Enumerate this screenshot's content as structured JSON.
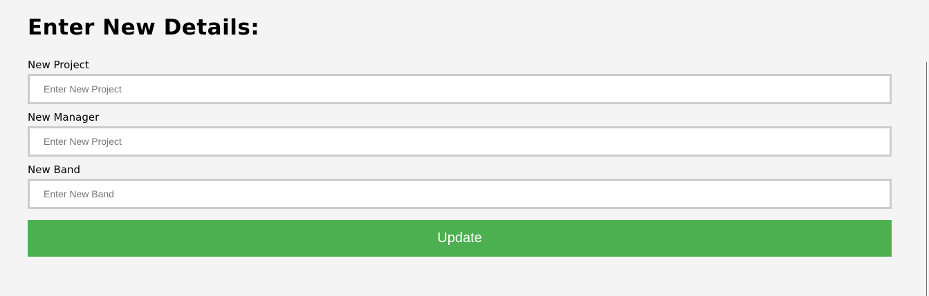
{
  "form": {
    "title": "Enter New Details:",
    "fields": [
      {
        "label": "New Project",
        "placeholder": "Enter New Project",
        "value": ""
      },
      {
        "label": "New Manager",
        "placeholder": "Enter New Project",
        "value": ""
      },
      {
        "label": "New Band",
        "placeholder": "Enter New Band",
        "value": ""
      }
    ],
    "submit_label": "Update"
  },
  "colors": {
    "background": "#f4f4f4",
    "input_border": "#cccccc",
    "button": "#4caf50",
    "button_text": "#ffffff"
  }
}
